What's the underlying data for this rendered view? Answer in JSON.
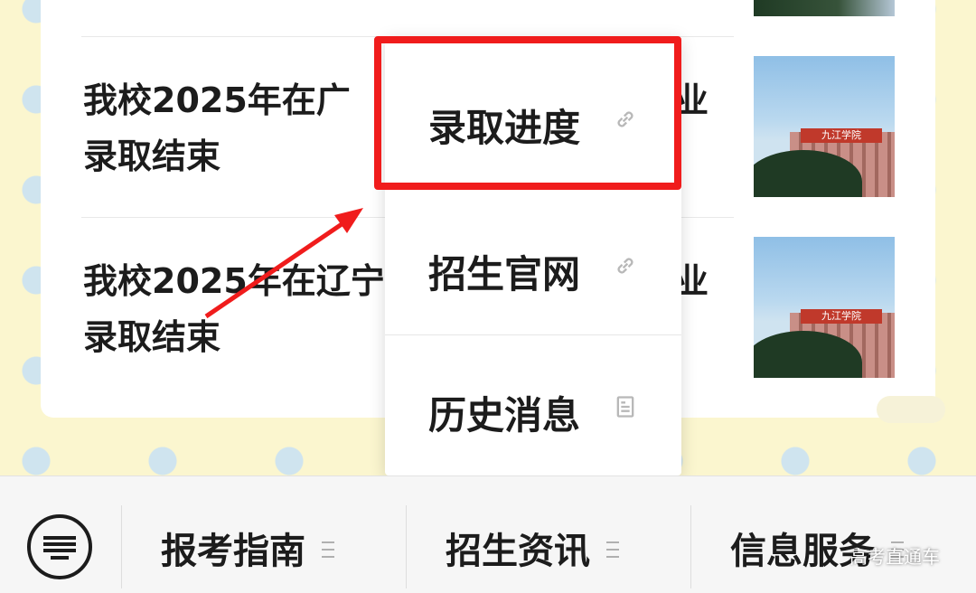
{
  "articles": [
    {
      "title_line1": "我校2025年在广",
      "title_tail": "业",
      "title_line2": "录取结束"
    },
    {
      "title_line1": "我校2025年在辽宁",
      "title_tail": "业",
      "title_line2": "录取结束"
    }
  ],
  "thumbnail_sign_text": "九江学院",
  "popup_menu": {
    "items": [
      {
        "label": "录取进度",
        "icon": "link-icon"
      },
      {
        "label": "招生官网",
        "icon": "link-icon"
      },
      {
        "label": "历史消息",
        "icon": "document-icon"
      }
    ]
  },
  "bottom_tabs": [
    {
      "label": "报考指南",
      "icon": "menu-lines-icon"
    },
    {
      "label": "招生资讯",
      "icon": "menu-lines-icon"
    },
    {
      "label": "信息服务",
      "icon": "menu-lines-icon"
    }
  ],
  "keyboard_icon": "keyboard-icon",
  "watermark": "高考直通车",
  "colors": {
    "highlight": "#f01c1c",
    "background": "#fbf6cf",
    "dots": "#cfe4ef"
  }
}
